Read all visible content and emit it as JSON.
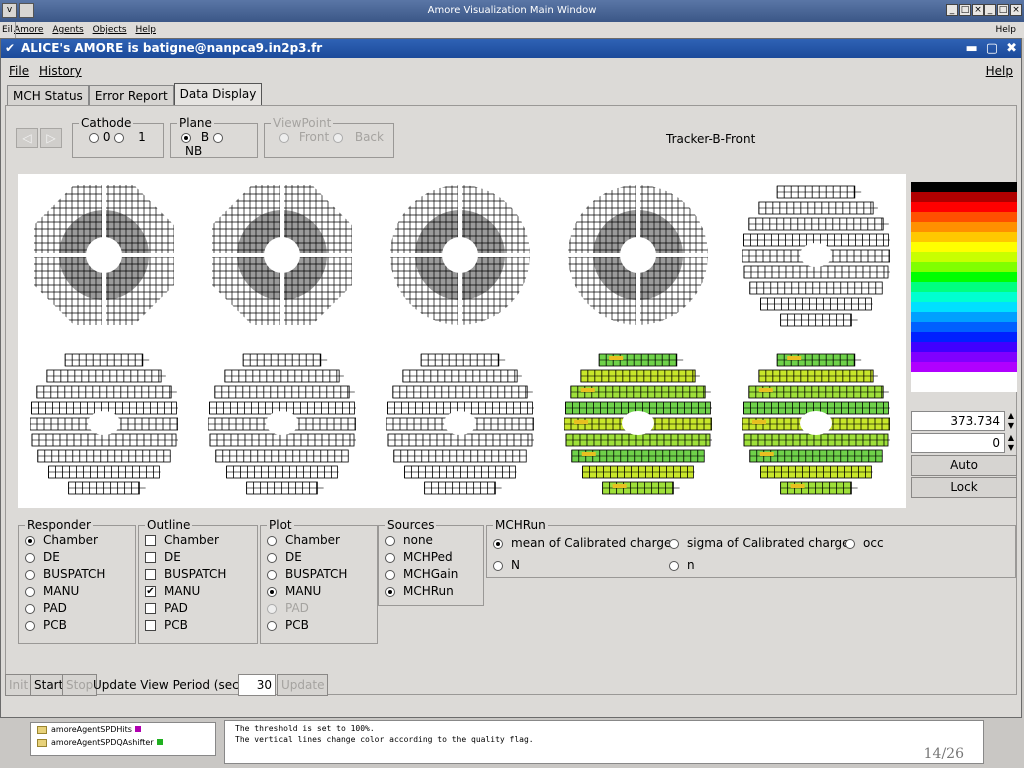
{
  "bg_window": {
    "title": "Amore Visualization Main Window",
    "menu": [
      "Amore",
      "Agents",
      "Objects",
      "Help"
    ],
    "file_menu": "Eil",
    "help_right": "Help"
  },
  "window": {
    "title": "ALICE's AMORE is batigne@nanpca9.in2p3.fr",
    "menu_file": "File",
    "menu_history": "History",
    "menu_help": "Help"
  },
  "tabs": [
    {
      "label": "MCH Status",
      "active": false
    },
    {
      "label": "Error Report",
      "active": false
    },
    {
      "label": "Data Display",
      "active": true
    }
  ],
  "controls": {
    "cathode": {
      "legend": "Cathode",
      "options": [
        "0",
        "1"
      ]
    },
    "plane": {
      "legend": "Plane",
      "options": [
        "B",
        "NB"
      ],
      "selected": "B"
    },
    "viewpoint": {
      "legend": "ViewPoint",
      "options": [
        "Front",
        "Back"
      ]
    },
    "tracker_title": "Tracker-B-Front"
  },
  "scale": {
    "max_value": "373.734",
    "min_value": "0",
    "auto_label": "Auto",
    "lock_label": "Lock",
    "colors": [
      "#000000",
      "#b00000",
      "#ff0000",
      "#ff5000",
      "#ff9000",
      "#ffc800",
      "#ffff00",
      "#c8ff00",
      "#80ff00",
      "#00ff00",
      "#00ff80",
      "#00ffd0",
      "#00e0ff",
      "#00a0ff",
      "#0060ff",
      "#0020ff",
      "#4000ff",
      "#8000ff",
      "#b000ff",
      "#ffffff",
      "#ffffff"
    ]
  },
  "responder": {
    "legend": "Responder",
    "options": [
      "Chamber",
      "DE",
      "BUSPATCH",
      "MANU",
      "PAD",
      "PCB"
    ],
    "selected": "Chamber"
  },
  "outline": {
    "legend": "Outline",
    "options": [
      "Chamber",
      "DE",
      "BUSPATCH",
      "MANU",
      "PAD",
      "PCB"
    ],
    "checked": "MANU"
  },
  "plot": {
    "legend": "Plot",
    "options": [
      "Chamber",
      "DE",
      "BUSPATCH",
      "MANU",
      "PAD",
      "PCB"
    ],
    "selected": "MANU"
  },
  "sources": {
    "legend": "Sources",
    "options": [
      "none",
      "MCHPed",
      "MCHGain",
      "MCHRun"
    ],
    "selected": "MCHRun"
  },
  "mchrun": {
    "legend": "MCHRun",
    "options": [
      "mean of Calibrated charge",
      "sigma of Calibrated charge",
      "occ",
      "N",
      "n"
    ],
    "selected": "mean of Calibrated charge"
  },
  "actions": {
    "init": "Init",
    "start": "Start",
    "stop": "Stop",
    "update_view_label": "Update View Period (sec)",
    "period": "30",
    "update": "Update"
  },
  "bg_bottom": {
    "tree_items": [
      "amoreAgentSPDHits",
      "amoreAgentSPDQAshifter"
    ],
    "log_lines": [
      "The threshold is set to 100%.",
      "The vertical lines change color according to the quality flag."
    ],
    "page": "14/26"
  }
}
